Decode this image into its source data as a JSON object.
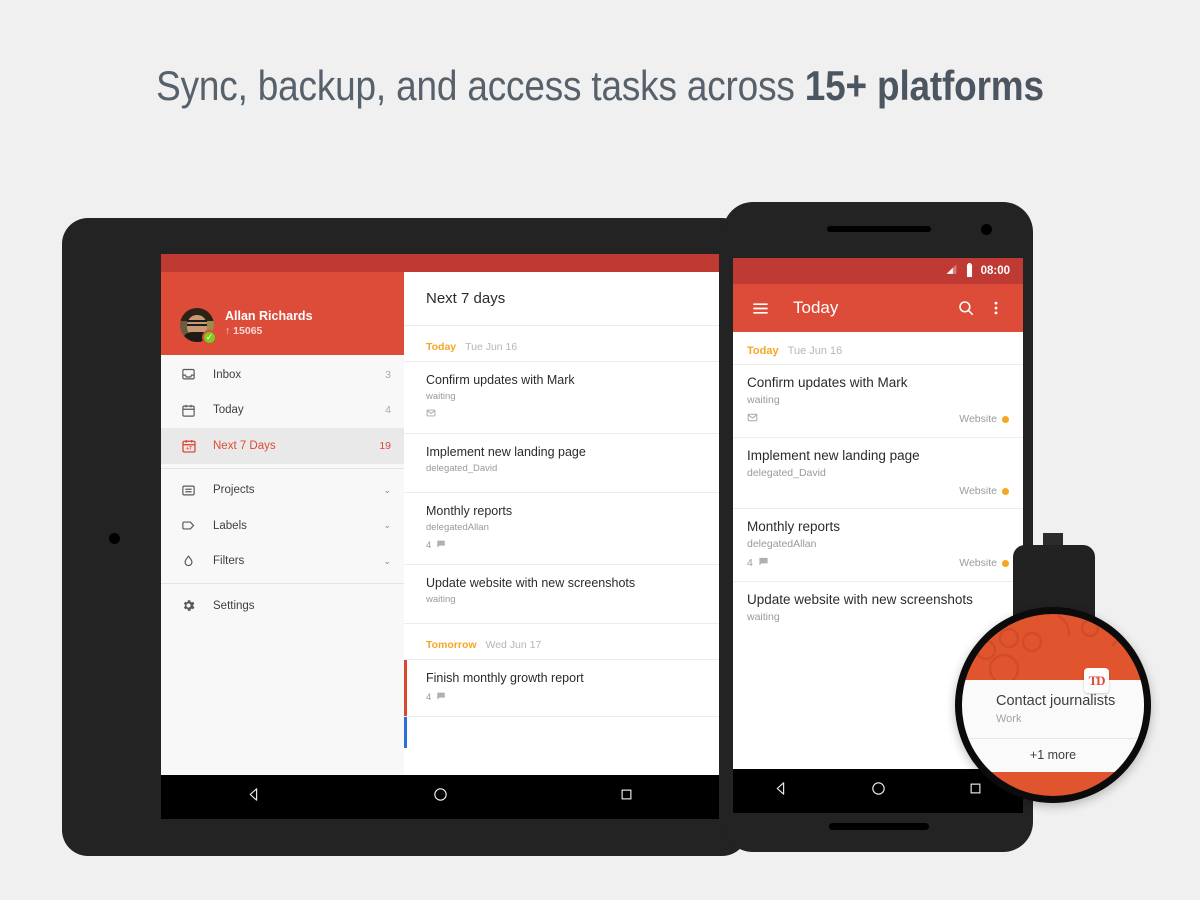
{
  "headline": {
    "text_normal": "Sync, backup, and access tasks across ",
    "text_strong": "15+ platforms"
  },
  "colors": {
    "background": "#f0f0f0",
    "brand_red": "#dd4b39",
    "status_red": "#bf3a32",
    "accent_orange": "#f5a623",
    "device_body": "#232323",
    "watch_face": "#e0542e"
  },
  "tablet": {
    "device_name": "Android tablet",
    "drawer": {
      "account": {
        "name": "Allan Richards",
        "karma": "15065",
        "karma_arrow": "↑",
        "karma_badge_icon": "karma-check-icon",
        "avatar_icon": "user-avatar-photo"
      },
      "items": [
        {
          "id": "inbox",
          "label": "Inbox",
          "count": "3",
          "icon": "inbox-icon",
          "active": false,
          "chevron": ""
        },
        {
          "id": "today",
          "label": "Today",
          "count": "4",
          "icon": "calendar-icon",
          "active": false,
          "chevron": ""
        },
        {
          "id": "next7",
          "label": "Next 7 Days",
          "count": "19",
          "icon": "calendar-plus7-icon",
          "active": true,
          "chevron": ""
        },
        {
          "id": "projects",
          "label": "Projects",
          "count": "",
          "icon": "projects-icon",
          "active": false,
          "chevron": "⌄"
        },
        {
          "id": "labels",
          "label": "Labels",
          "count": "",
          "icon": "label-tag-icon",
          "active": false,
          "chevron": "⌄"
        },
        {
          "id": "filters",
          "label": "Filters",
          "count": "",
          "icon": "filter-drop-icon",
          "active": false,
          "chevron": "⌄"
        },
        {
          "id": "settings",
          "label": "Settings",
          "count": "",
          "icon": "gear-icon",
          "active": false,
          "chevron": ""
        }
      ]
    },
    "content": {
      "title": "Next 7 days",
      "groups": [
        {
          "label": "Today",
          "date": "Tue Jun 16",
          "tasks": [
            {
              "title": "Confirm updates with Mark",
              "sub": "waiting",
              "comments": "",
              "icon": "email-icon",
              "priority_color": ""
            },
            {
              "title": "Implement new landing page",
              "sub": "delegated_David",
              "comments": "",
              "icon": "",
              "priority_color": ""
            },
            {
              "title": "Monthly reports",
              "sub": "delegatedAllan",
              "comments": "4",
              "icon": "comment-icon",
              "priority_color": ""
            },
            {
              "title": "Update website with new screenshots",
              "sub": "waiting",
              "comments": "",
              "icon": "",
              "priority_color": ""
            }
          ]
        },
        {
          "label": "Tomorrow",
          "date": "Wed Jun 17",
          "tasks": [
            {
              "title": "Finish monthly growth report",
              "sub": "",
              "comments": "4",
              "icon": "comment-icon",
              "priority_color": "#d6492f"
            }
          ]
        }
      ]
    },
    "navbar": {
      "back": "back-triangle-icon",
      "home": "home-circle-icon",
      "recents": "recents-square-icon"
    }
  },
  "phone": {
    "device_name": "Android phone",
    "statusbar": {
      "time": "08:00",
      "signal_icon": "signal-bars-icon",
      "battery_icon": "battery-icon"
    },
    "appbar": {
      "menu_icon": "hamburger-menu-icon",
      "title": "Today",
      "search_icon": "search-icon",
      "overflow_icon": "more-vertical-icon"
    },
    "groups": [
      {
        "label": "Today",
        "date": "Tue Jun 16",
        "tasks": [
          {
            "title": "Confirm updates with Mark",
            "sub": "waiting",
            "comments": "",
            "icon": "email-icon",
            "project": "Website",
            "project_color": "#f5a623"
          },
          {
            "title": "Implement new landing page",
            "sub": "delegated_David",
            "comments": "",
            "icon": "",
            "project": "Website",
            "project_color": "#f5a623"
          },
          {
            "title": "Monthly reports",
            "sub": "delegatedAllan",
            "comments": "4",
            "icon": "comment-icon",
            "project": "Website",
            "project_color": "#f5a623"
          },
          {
            "title": "Update website with new screenshots",
            "sub": "waiting",
            "comments": "",
            "icon": "",
            "project": "",
            "project_color": ""
          }
        ]
      }
    ],
    "navbar": {
      "back": "back-triangle-icon",
      "home": "home-circle-icon",
      "recents": "recents-square-icon"
    }
  },
  "watch": {
    "device_name": "Android Wear smartwatch",
    "logo_text": "TD",
    "card": {
      "title": "Contact journalists",
      "project": "Work"
    },
    "more_label": "+1 more"
  }
}
